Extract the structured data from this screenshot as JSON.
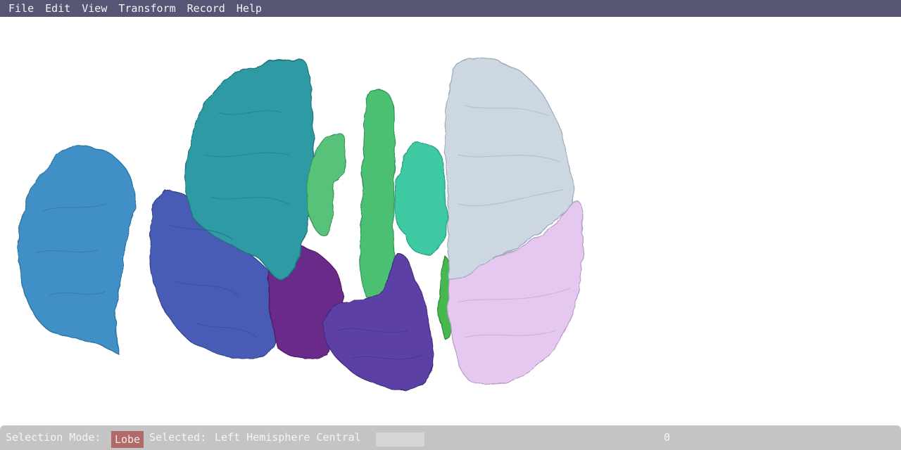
{
  "menu": [
    "File",
    "Edit",
    "View",
    "Transform",
    "Record",
    "Help"
  ],
  "status": {
    "selection_mode_label": "Selection Mode:",
    "selection_mode_value": "Lobe",
    "selected_label": "Selected:",
    "selected_value": "Left Hemisphere Central",
    "counter": "0"
  },
  "colors": {
    "menubar_bg": "#575574",
    "statusbar_bg": "#c4c4c4",
    "mode_badge": "#b06a6a"
  }
}
